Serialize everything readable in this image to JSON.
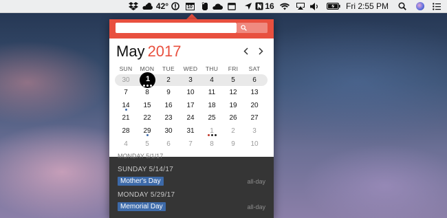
{
  "menubar": {
    "temperature": "42°",
    "battery_percent": "16",
    "clock": "Fri 2:55 PM",
    "calendar_icon_day": "10",
    "icons": [
      "dropbox-icon",
      "weather-cloud-sun-icon",
      "info-icon",
      "calendar-icon",
      "evernote-icon",
      "cloud-icon",
      "fantastical-icon",
      "location-arrow-icon",
      "evernote-badge-icon",
      "wifi-icon",
      "airplay-icon",
      "volume-icon",
      "battery-icon",
      "search-icon",
      "siri-icon",
      "notification-center-icon"
    ]
  },
  "calendar": {
    "search_placeholder": "",
    "month": "May",
    "year": "2017",
    "weekdays": [
      "SUN",
      "MON",
      "TUE",
      "WED",
      "THU",
      "FRI",
      "SAT"
    ],
    "weeks": [
      [
        "30",
        "1",
        "2",
        "3",
        "4",
        "5",
        "6"
      ],
      [
        "7",
        "8",
        "9",
        "10",
        "11",
        "12",
        "13"
      ],
      [
        "14",
        "15",
        "16",
        "17",
        "18",
        "19",
        "20"
      ],
      [
        "21",
        "22",
        "23",
        "24",
        "25",
        "26",
        "27"
      ],
      [
        "28",
        "29",
        "30",
        "31",
        "1",
        "2",
        "3"
      ],
      [
        "4",
        "5",
        "6",
        "7",
        "8",
        "9",
        "10"
      ]
    ],
    "today": "1",
    "colors": {
      "accent": "#e8503f",
      "event_blue": "#3d6aa9",
      "agenda_bg": "#353535"
    }
  },
  "agenda": {
    "cut_off_text": "MONDAY 5/1/17",
    "items": [
      {
        "date": "SUNDAY 5/14/17",
        "title": "Mother's Day",
        "time": "all-day"
      },
      {
        "date": "MONDAY 5/29/17",
        "title": "Memorial Day",
        "time": "all-day"
      }
    ]
  }
}
